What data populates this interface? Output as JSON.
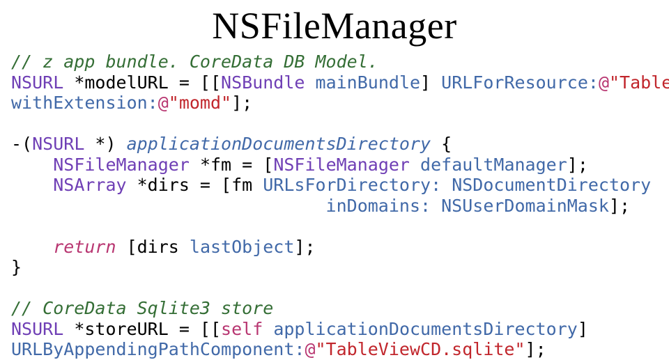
{
  "title": "NSFileManager",
  "code": {
    "sp": " ",
    "at": "@",
    "ind4": "    ",
    "ind30": "                              ",
    "l1": "// z app bundle. CoreData DB Model.",
    "l2a": "NSURL",
    "l2b": " *modelURL = [[",
    "l2c": "NSBundle",
    "l2d": "mainBundle",
    "l2e": "] ",
    "l2f": "URLForResource:",
    "l2g": "\"TableViewCD\"",
    "l3a": "withExtension:",
    "l3b": "\"momd\"",
    "l3c": "];",
    "l5a": "-(",
    "l5b": "NSURL",
    "l5c": " *) ",
    "l5d": "applicationDocumentsDirectory",
    "l5e": " {",
    "l6a": "NSFileManager",
    "l6b": " *fm = [",
    "l6c": "NSFileManager",
    "l6d": "defaultManager",
    "l6e": "];",
    "l7a": "NSArray",
    "l7b": " *dirs = [fm ",
    "l7c": "URLsForDirectory:",
    "l7d": "NSDocumentDirectory",
    "l8a": "inDomains:",
    "l8b": "NSUserDomainMask",
    "l8c": "];",
    "l10a": "return",
    "l10b": " [dirs ",
    "l10c": "lastObject",
    "l10d": "];",
    "l11": "}",
    "l13": "// CoreData Sqlite3 store",
    "l14a": "NSURL",
    "l14b": " *storeURL = [[",
    "l14c": "self",
    "l14d": "applicationDocumentsDirectory",
    "l14e": "]",
    "l15a": "URLByAppendingPathComponent:",
    "l15b": "\"TableViewCD.sqlite\"",
    "l15c": "];"
  }
}
